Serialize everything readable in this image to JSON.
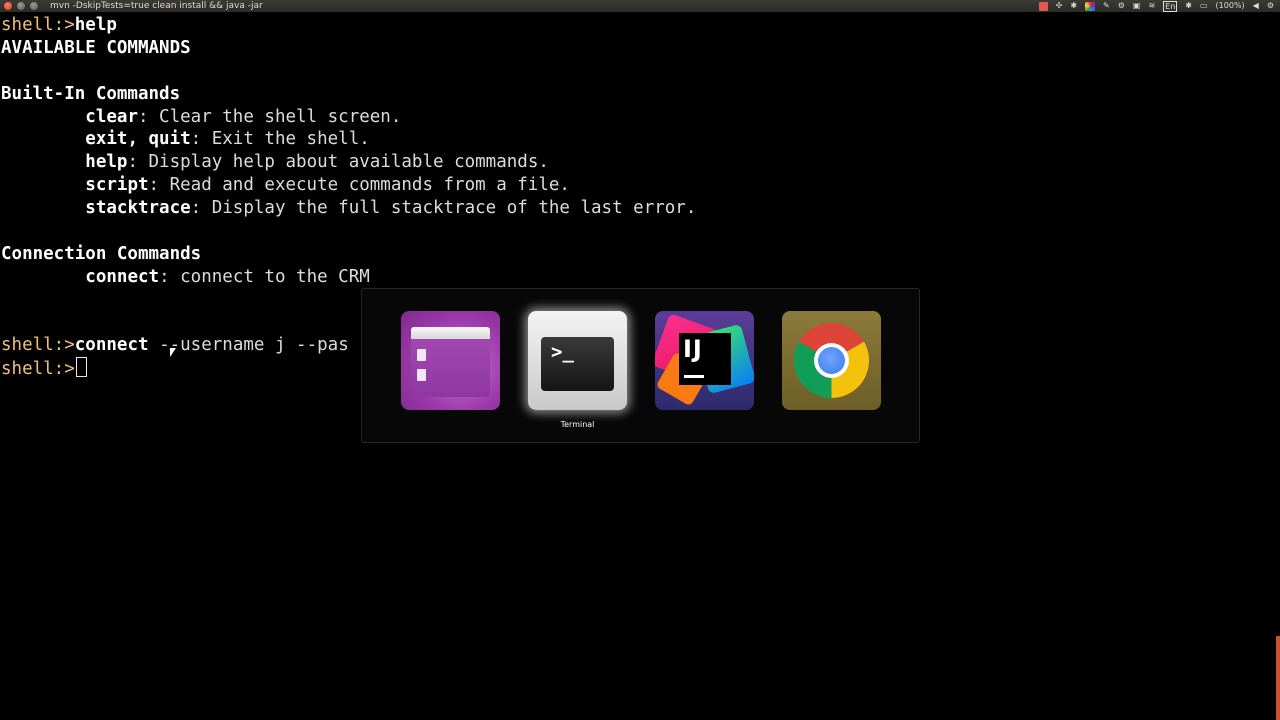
{
  "window": {
    "title": "mvn -DskipTests=true clean install && java -jar"
  },
  "tray": {
    "keyboard_layout": "En",
    "battery": "(100%)"
  },
  "terminal": {
    "lines": [
      [
        {
          "t": "shell:>",
          "c": "prompt"
        },
        {
          "t": "help",
          "c": "bold"
        }
      ],
      [
        {
          "t": "AVAILABLE COMMANDS",
          "c": "bold"
        }
      ],
      [],
      [
        {
          "t": "Built-In Commands",
          "c": "bold"
        }
      ],
      [
        {
          "t": "        "
        },
        {
          "t": "clear",
          "c": "bold"
        },
        {
          "t": ": Clear the shell screen.",
          "c": "dim"
        }
      ],
      [
        {
          "t": "        "
        },
        {
          "t": "exit, quit",
          "c": "bold"
        },
        {
          "t": ": Exit the shell.",
          "c": "dim"
        }
      ],
      [
        {
          "t": "        "
        },
        {
          "t": "help",
          "c": "bold"
        },
        {
          "t": ": Display help about available commands.",
          "c": "dim"
        }
      ],
      [
        {
          "t": "        "
        },
        {
          "t": "script",
          "c": "bold"
        },
        {
          "t": ": Read and execute commands from a file.",
          "c": "dim"
        }
      ],
      [
        {
          "t": "        "
        },
        {
          "t": "stacktrace",
          "c": "bold"
        },
        {
          "t": ": Display the full stacktrace of the last error.",
          "c": "dim"
        }
      ],
      [],
      [
        {
          "t": "Connection Commands",
          "c": "bold"
        }
      ],
      [
        {
          "t": "        "
        },
        {
          "t": "connect",
          "c": "bold"
        },
        {
          "t": ": connect to the CRM",
          "c": "dim"
        }
      ],
      [],
      [],
      [
        {
          "t": "shell:>",
          "c": "prompt"
        },
        {
          "t": "connect",
          "c": "bold"
        },
        {
          "t": " --username j --pa",
          "c": "dim"
        },
        {
          "t": "s",
          "c": "dim"
        }
      ],
      [
        {
          "t": "shell:>",
          "c": "prompt"
        }
      ]
    ]
  },
  "app_switcher": {
    "apps": [
      {
        "name": "files-icon"
      },
      {
        "name": "terminal-icon",
        "label": "Terminal",
        "selected": true
      },
      {
        "name": "intellij-icon",
        "glyph": "IJ"
      },
      {
        "name": "chrome-icon"
      }
    ],
    "selected_label": "Terminal"
  },
  "icons": {
    "terminal_glyph": ">_"
  }
}
